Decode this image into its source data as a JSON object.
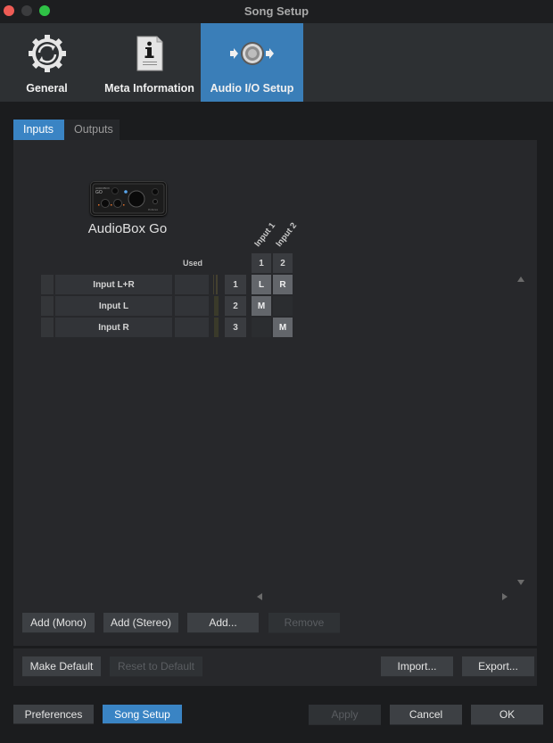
{
  "window": {
    "title": "Song Setup"
  },
  "toolbar": {
    "items": [
      {
        "label": "General",
        "icon": "gear-refresh-icon",
        "active": false
      },
      {
        "label": "Meta Information",
        "icon": "info-document-icon",
        "active": false
      },
      {
        "label": "Audio I/O Setup",
        "icon": "audio-io-speaker-icon",
        "active": true
      }
    ]
  },
  "tabs": [
    {
      "label": "Inputs",
      "active": true
    },
    {
      "label": "Outputs",
      "active": false
    }
  ],
  "device": {
    "name": "AudioBox Go",
    "image": "audiobox-go-device-image"
  },
  "matrix": {
    "used_header": "Used",
    "column_headers": [
      "Input 1",
      "Input 2"
    ],
    "column_numbers": [
      "1",
      "2"
    ],
    "rows": [
      {
        "name": "Input L+R",
        "number": "1",
        "cells": [
          "L",
          "R"
        ]
      },
      {
        "name": "Input L",
        "number": "2",
        "cells": [
          "M",
          ""
        ]
      },
      {
        "name": "Input R",
        "number": "3",
        "cells": [
          "",
          "M"
        ]
      }
    ]
  },
  "panel_buttons": {
    "add_mono": "Add (Mono)",
    "add_stereo": "Add (Stereo)",
    "add": "Add...",
    "remove": "Remove"
  },
  "preset_buttons": {
    "make_default": "Make Default",
    "reset_default": "Reset to Default",
    "import": "Import...",
    "export": "Export..."
  },
  "footer": {
    "preferences": "Preferences",
    "song_setup": "Song Setup",
    "apply": "Apply",
    "cancel": "Cancel",
    "ok": "OK"
  },
  "colors": {
    "accent": "#3a84c4",
    "toolbar_active": "#3a7eb8",
    "background": "#1b1c1e",
    "panel": "#27282b"
  }
}
